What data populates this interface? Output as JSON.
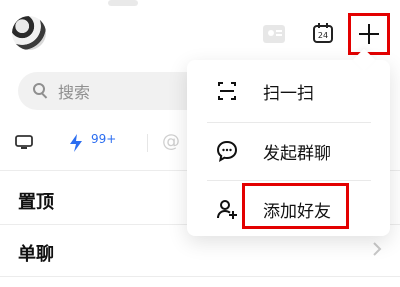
{
  "header": {
    "avatar_alt": "",
    "top_blur_text": ""
  },
  "search": {
    "placeholder": "搜索"
  },
  "quick_filters": {
    "badge": "99+",
    "at_symbol": "@"
  },
  "sections": {
    "pinned": "置顶",
    "direct": "单聊"
  },
  "popup_menu": {
    "items": [
      {
        "label": "扫一扫",
        "icon": "scan-icon"
      },
      {
        "label": "发起群聊",
        "icon": "chat-bubble-icon"
      },
      {
        "label": "添加好友",
        "icon": "add-user-icon"
      }
    ]
  },
  "toolbar": {
    "calendar_day": "24"
  },
  "colors": {
    "highlight": "#e30000",
    "accent": "#2b6df0",
    "muted": "#8f8f8f"
  }
}
